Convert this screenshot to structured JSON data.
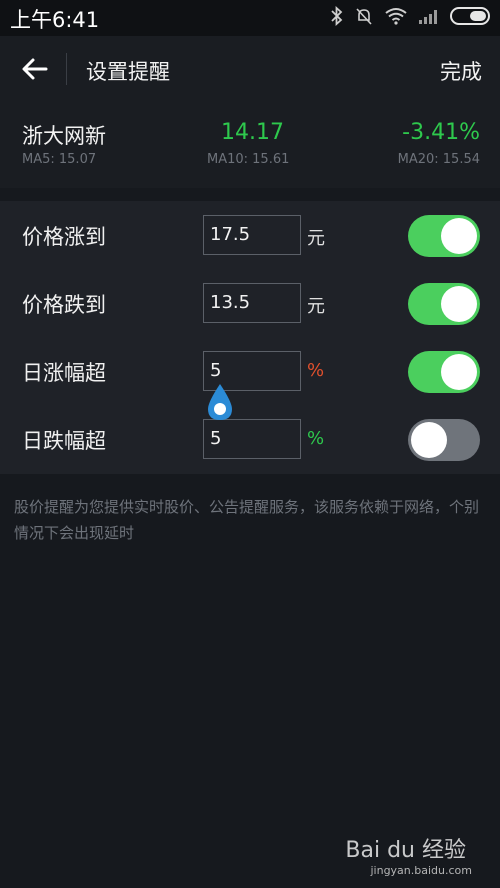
{
  "status_bar": {
    "time": "上午6:41",
    "icons": [
      "bluetooth-icon",
      "mute-bell-icon",
      "wifi-icon",
      "signal-icon",
      "battery-icon"
    ]
  },
  "header": {
    "title": "设置提醒",
    "done_label": "完成",
    "back_icon": "arrow-left-icon"
  },
  "quote": {
    "name": "浙大网新",
    "price": "14.17",
    "change": "-3.41%",
    "ma5": "MA5: 15.07",
    "ma10": "MA10: 15.61",
    "ma20": "MA20: 15.54",
    "price_color": "#2ec94d"
  },
  "alerts": [
    {
      "label": "价格涨到",
      "value": "17.5",
      "unit": "元",
      "enabled": true
    },
    {
      "label": "价格跌到",
      "value": "13.5",
      "unit": "元",
      "enabled": true
    },
    {
      "label": "日涨幅超",
      "value": "5",
      "unit": "%",
      "enabled": true
    },
    {
      "label": "日跌幅超",
      "value": "5",
      "unit": "%",
      "enabled": false
    }
  ],
  "note": "股价提醒为您提供实时股价、公告提醒服务，该服务依赖于网络，个别情况下会出现延时",
  "watermark": {
    "text": "Bai du 经验",
    "url": "jingyan.baidu.com"
  },
  "colors": {
    "toggle_on": "#4bcf5e",
    "toggle_off": "#6f747b",
    "up": "#e0502d",
    "down": "#2ec94d"
  }
}
